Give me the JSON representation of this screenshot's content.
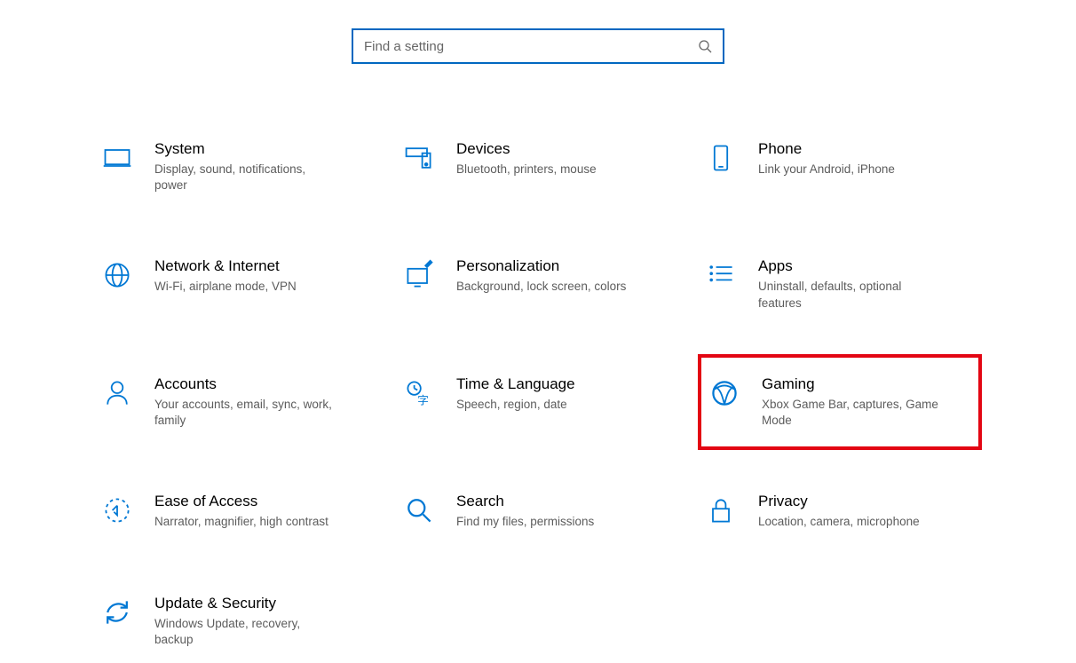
{
  "search": {
    "placeholder": "Find a setting"
  },
  "tiles": [
    {
      "id": "system",
      "title": "System",
      "desc": "Display, sound, notifications, power"
    },
    {
      "id": "devices",
      "title": "Devices",
      "desc": "Bluetooth, printers, mouse"
    },
    {
      "id": "phone",
      "title": "Phone",
      "desc": "Link your Android, iPhone"
    },
    {
      "id": "network",
      "title": "Network & Internet",
      "desc": "Wi-Fi, airplane mode, VPN"
    },
    {
      "id": "personalization",
      "title": "Personalization",
      "desc": "Background, lock screen, colors"
    },
    {
      "id": "apps",
      "title": "Apps",
      "desc": "Uninstall, defaults, optional features"
    },
    {
      "id": "accounts",
      "title": "Accounts",
      "desc": "Your accounts, email, sync, work, family"
    },
    {
      "id": "time",
      "title": "Time & Language",
      "desc": "Speech, region, date"
    },
    {
      "id": "gaming",
      "title": "Gaming",
      "desc": "Xbox Game Bar, captures, Game Mode",
      "highlighted": true
    },
    {
      "id": "ease",
      "title": "Ease of Access",
      "desc": "Narrator, magnifier, high contrast"
    },
    {
      "id": "search",
      "title": "Search",
      "desc": "Find my files, permissions"
    },
    {
      "id": "privacy",
      "title": "Privacy",
      "desc": "Location, camera, microphone"
    },
    {
      "id": "update",
      "title": "Update & Security",
      "desc": "Windows Update, recovery, backup"
    }
  ]
}
